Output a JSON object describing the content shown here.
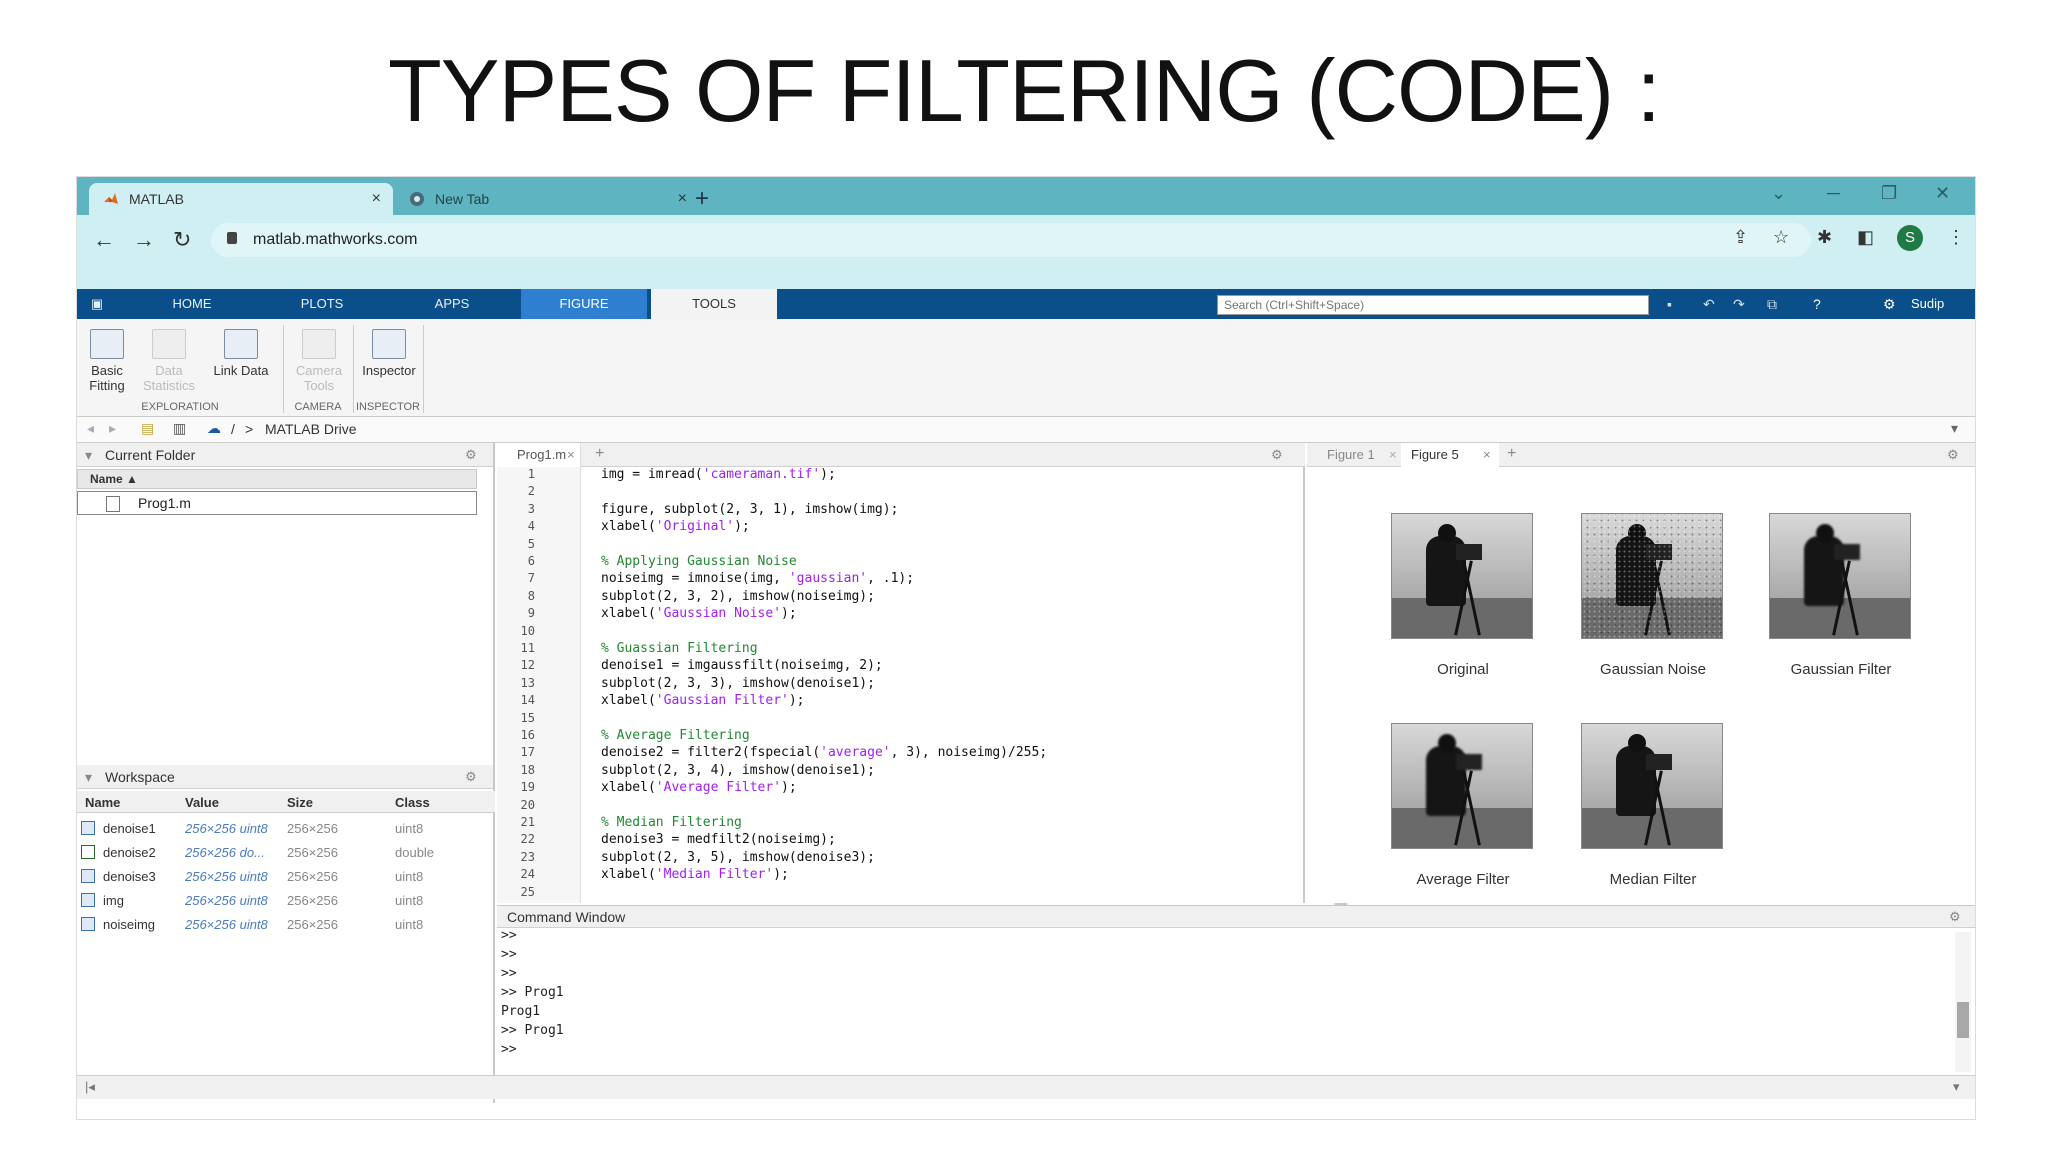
{
  "slide": {
    "title": "TYPES OF FILTERING (CODE) :"
  },
  "browser": {
    "tabs": [
      {
        "label": "MATLAB",
        "active": true
      },
      {
        "label": "New Tab",
        "active": false
      }
    ],
    "new_tab_symbol": "+",
    "close_symbol": "×",
    "url": "matlab.mathworks.com",
    "avatar_letter": "S",
    "accent_color": "#5fb4c2"
  },
  "toolstrip": {
    "tabs": [
      "HOME",
      "PLOTS",
      "APPS",
      "FIGURE",
      "TOOLS"
    ],
    "search_placeholder": "Search (Ctrl+Shift+Space)",
    "user": "Sudip",
    "buttons": [
      {
        "line1": "Basic",
        "line2": "Fitting",
        "enabled": true
      },
      {
        "line1": "Data",
        "line2": "Statistics",
        "enabled": false
      },
      {
        "line1": "Link Data",
        "line2": "",
        "enabled": true
      },
      {
        "line1": "Camera",
        "line2": "Tools",
        "enabled": false
      },
      {
        "line1": "Inspector",
        "line2": "",
        "enabled": true
      }
    ],
    "groups": [
      "EXPLORATION",
      "CAMERA",
      "INSPECTOR"
    ]
  },
  "path": {
    "root": "/",
    "separator": ">",
    "folder": "MATLAB Drive"
  },
  "current_folder": {
    "title": "Current Folder",
    "column_name": "Name ▲",
    "files": [
      "Prog1.m"
    ]
  },
  "workspace": {
    "title": "Workspace",
    "columns": [
      "Name",
      "Value",
      "Size",
      "Class"
    ],
    "rows": [
      {
        "name": "denoise1",
        "value": "256×256 uint8",
        "size": "256×256",
        "class": "uint8"
      },
      {
        "name": "denoise2",
        "value": "256×256 do...",
        "size": "256×256",
        "class": "double"
      },
      {
        "name": "denoise3",
        "value": "256×256 uint8",
        "size": "256×256",
        "class": "uint8"
      },
      {
        "name": "img",
        "value": "256×256 uint8",
        "size": "256×256",
        "class": "uint8"
      },
      {
        "name": "noiseimg",
        "value": "256×256 uint8",
        "size": "256×256",
        "class": "uint8"
      }
    ]
  },
  "editor": {
    "tab": "Prog1.m",
    "lines": [
      [
        [
          "t",
          "img = imread("
        ],
        [
          "s",
          "'cameraman.tif'"
        ],
        [
          "t",
          ");"
        ]
      ],
      [],
      [
        [
          "t",
          "figure, subplot(2, 3, 1), imshow(img);"
        ]
      ],
      [
        [
          "t",
          "xlabel("
        ],
        [
          "s",
          "'Original'"
        ],
        [
          "t",
          ");"
        ]
      ],
      [],
      [
        [
          "c",
          "% Applying Gaussian Noise"
        ]
      ],
      [
        [
          "t",
          "noiseimg = imnoise(img, "
        ],
        [
          "s",
          "'gaussian'"
        ],
        [
          "t",
          ", .1);"
        ]
      ],
      [
        [
          "t",
          "subplot(2, 3, 2), imshow(noiseimg);"
        ]
      ],
      [
        [
          "t",
          "xlabel("
        ],
        [
          "s",
          "'Gaussian Noise'"
        ],
        [
          "t",
          ");"
        ]
      ],
      [],
      [
        [
          "c",
          "% Guassian Filtering"
        ]
      ],
      [
        [
          "t",
          "denoise1 = imgaussfilt(noiseimg, 2);"
        ]
      ],
      [
        [
          "t",
          "subplot(2, 3, 3), imshow(denoise1);"
        ]
      ],
      [
        [
          "t",
          "xlabel("
        ],
        [
          "s",
          "'Gaussian Filter'"
        ],
        [
          "t",
          ");"
        ]
      ],
      [],
      [
        [
          "c",
          "% Average Filtering"
        ]
      ],
      [
        [
          "t",
          "denoise2 = filter2(fspecial("
        ],
        [
          "s",
          "'average'"
        ],
        [
          "t",
          ", 3), noiseimg)/255;"
        ]
      ],
      [
        [
          "t",
          "subplot(2, 3, 4), imshow(denoise1);"
        ]
      ],
      [
        [
          "t",
          "xlabel("
        ],
        [
          "s",
          "'Average Filter'"
        ],
        [
          "t",
          ");"
        ]
      ],
      [],
      [
        [
          "c",
          "% Median Filtering"
        ]
      ],
      [
        [
          "t",
          "denoise3 = medfilt2(noiseimg);"
        ]
      ],
      [
        [
          "t",
          "subplot(2, 3, 5), imshow(denoise3);"
        ]
      ],
      [
        [
          "t",
          "xlabel("
        ],
        [
          "s",
          "'Median Filter'"
        ],
        [
          "t",
          ");"
        ]
      ],
      []
    ]
  },
  "figures": {
    "tabs": [
      "Figure 1",
      "Figure 5"
    ],
    "captions": [
      "Original",
      "Gaussian Noise",
      "Gaussian Filter",
      "Average Filter",
      "Median Filter"
    ]
  },
  "command_window": {
    "title": "Command Window",
    "lines": [
      ">>",
      ">>",
      ">>",
      ">> Prog1",
      "Prog1",
      ">> Prog1",
      ">>"
    ]
  }
}
